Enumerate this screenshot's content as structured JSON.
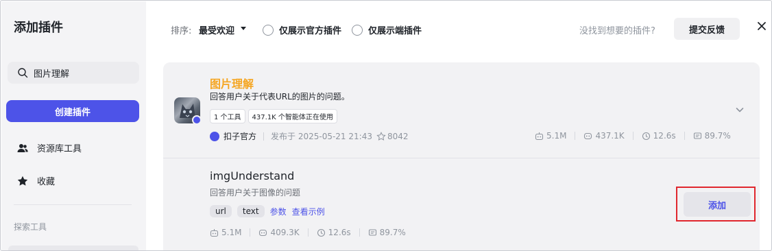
{
  "sidebar": {
    "title": "添加插件",
    "search_text": "图片理解",
    "create_label": "创建插件",
    "items": [
      {
        "label": "资源库工具",
        "icon": "users-icon"
      },
      {
        "label": "收藏",
        "icon": "star-icon"
      }
    ],
    "section_label": "探索工具"
  },
  "topbar": {
    "sort_label": "排序:",
    "sort_value": "最受欢迎",
    "radio_official": "仅展示官方插件",
    "radio_terminal": "仅展示端插件",
    "hint": "没找到想要的插件?",
    "feedback_label": "提交反馈"
  },
  "plugin": {
    "name": "图片理解",
    "description": "回答用户关于代表URL的图片的问题。",
    "tags": [
      "1 个工具",
      "437.1K 个智能体正在使用"
    ],
    "publisher": "扣子官方",
    "published": "发布于 2025-05-21 21:43",
    "stars": "8042",
    "stats": {
      "calls": "5.1M",
      "bots": "437.1K",
      "latency": "12.6s",
      "success": "89.7%"
    }
  },
  "tool": {
    "name": "imgUnderstand",
    "description": "回答用户关于图像的问题",
    "params": [
      "url",
      "text"
    ],
    "params_link": "参数",
    "example_link": "查看示例",
    "stats": {
      "calls": "5.1M",
      "bots": "409.3K",
      "latency": "12.6s",
      "success": "89.7%"
    },
    "add_label": "添加"
  },
  "colors": {
    "accent": "#4d53e8",
    "plugin_name": "#f5a623",
    "highlight": "#e0262d"
  }
}
